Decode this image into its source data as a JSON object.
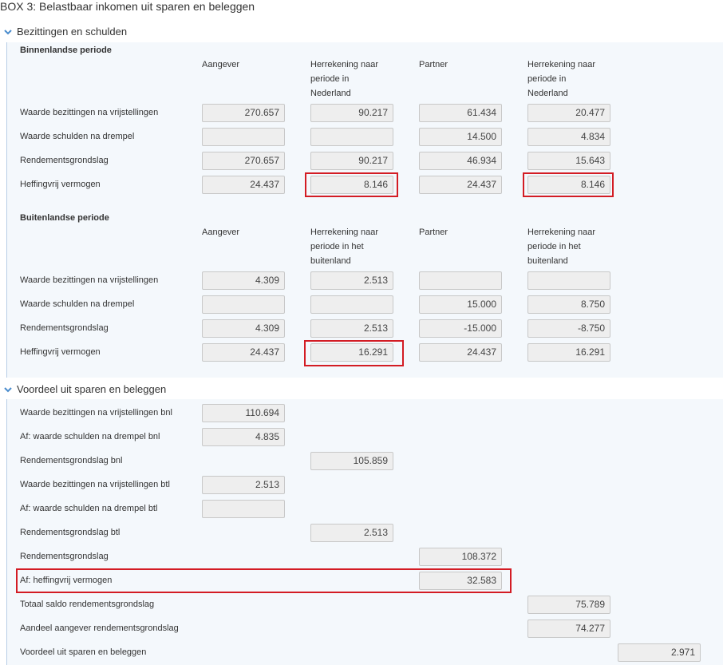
{
  "page_title": "BOX 3: Belastbaar inkomen uit sparen en beleggen",
  "sections": {
    "bezittingen": {
      "heading": "Bezittingen en schulden"
    },
    "voordeel": {
      "heading": "Voordeel uit sparen en beleggen"
    }
  },
  "binnenlands": {
    "heading": "Binnenlandse periode",
    "col_aangever": "Aangever",
    "col_herrekening_line1": "Herrekening naar",
    "col_herrekening_line2": "periode in",
    "col_herrekening_line3": "Nederland",
    "col_partner": "Partner",
    "rows": [
      {
        "label": "Waarde bezittingen na vrijstellingen",
        "aangever": "270.657",
        "herrekening_a": "90.217",
        "partner": "61.434",
        "herrekening_p": "20.477"
      },
      {
        "label": "Waarde schulden na drempel",
        "aangever": "",
        "herrekening_a": "",
        "partner": "14.500",
        "herrekening_p": "4.834"
      },
      {
        "label": "Rendementsgrondslag",
        "aangever": "270.657",
        "herrekening_a": "90.217",
        "partner": "46.934",
        "herrekening_p": "15.643"
      },
      {
        "label": "Heffingvrij vermogen",
        "aangever": "24.437",
        "herrekening_a": "8.146",
        "partner": "24.437",
        "herrekening_p": "8.146"
      }
    ]
  },
  "buitenlands": {
    "heading": "Buitenlandse periode",
    "col_aangever": "Aangever",
    "col_herrekening_line1": "Herrekening naar",
    "col_herrekening_line2": "periode in het",
    "col_herrekening_line3": "buitenland",
    "col_partner": "Partner",
    "rows": [
      {
        "label": "Waarde bezittingen na vrijstellingen",
        "aangever": "4.309",
        "herrekening_a": "2.513",
        "partner": "",
        "herrekening_p": ""
      },
      {
        "label": "Waarde schulden na drempel",
        "aangever": "",
        "herrekening_a": "",
        "partner": "15.000",
        "herrekening_p": "8.750"
      },
      {
        "label": "Rendementsgrondslag",
        "aangever": "4.309",
        "herrekening_a": "2.513",
        "partner": "-15.000",
        "herrekening_p": "-8.750"
      },
      {
        "label": "Heffingvrij vermogen",
        "aangever": "24.437",
        "herrekening_a": "16.291",
        "partner": "24.437",
        "herrekening_p": "16.291"
      }
    ]
  },
  "voordeel_rows": [
    {
      "label": "Waarde bezittingen na vrijstellingen bnl",
      "value": "110.694"
    },
    {
      "label": "Af: waarde schulden na drempel bnl",
      "value": "4.835"
    },
    {
      "label": "Rendementsgrondslag bnl",
      "value": "105.859"
    },
    {
      "label": "Waarde bezittingen na vrijstellingen btl",
      "value": "2.513"
    },
    {
      "label": "Af: waarde schulden na drempel btl",
      "value": ""
    },
    {
      "label": "Rendementsgrondslag btl",
      "value": "2.513"
    },
    {
      "label": "Rendementsgrondslag",
      "value": "108.372"
    },
    {
      "label": "Af: heffingvrij vermogen",
      "value": "32.583"
    },
    {
      "label": "Totaal saldo rendementsgrondslag",
      "value": "75.789"
    },
    {
      "label": "Aandeel aangever rendementsgrondslag",
      "value": "74.277"
    },
    {
      "label": "Voordeel uit sparen en beleggen",
      "value": "2.971"
    }
  ],
  "colors": {
    "panel": "#f4f8fc",
    "accent": "#4a8ccd",
    "highlight": "#d31c24",
    "field": "#eeeeee"
  }
}
